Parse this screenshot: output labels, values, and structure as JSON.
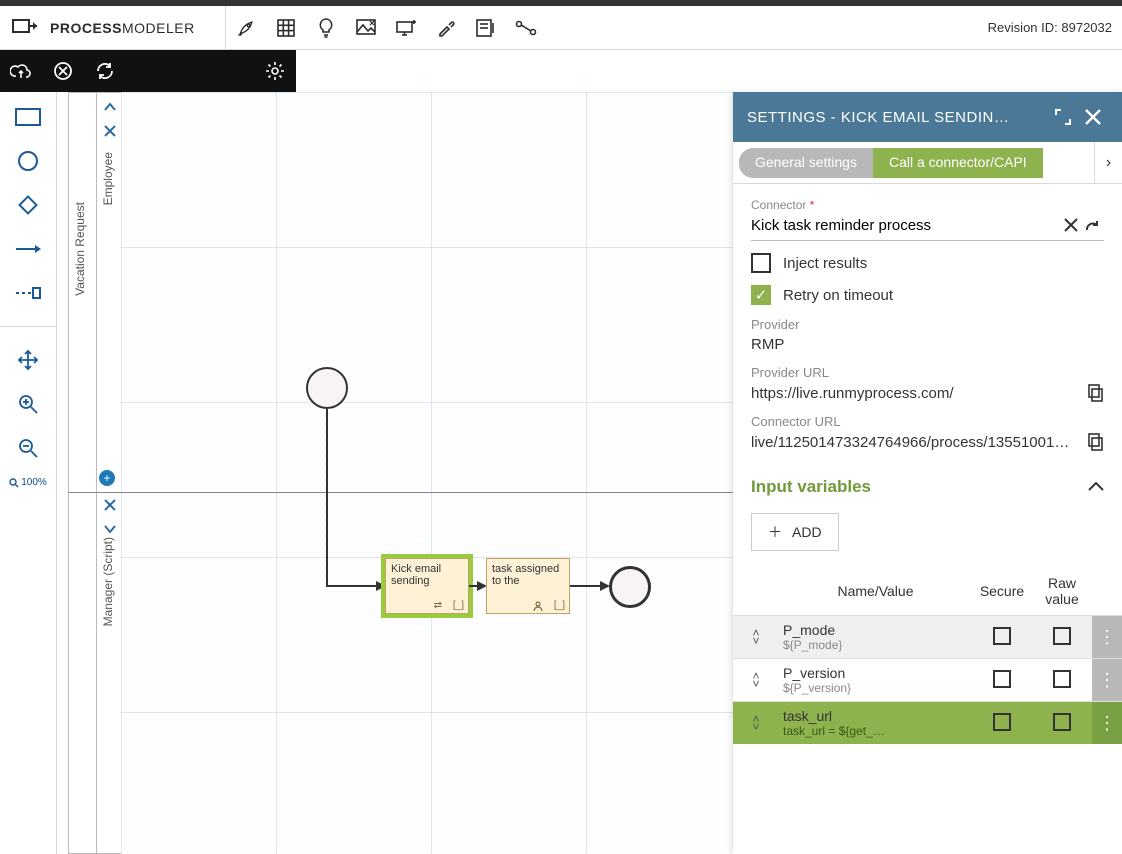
{
  "brand": {
    "strong": "PROCESS",
    "light": "MODELER"
  },
  "revision": {
    "label": "Revision ID: ",
    "value": "8972032"
  },
  "palette_zoom": "100%",
  "lanes": {
    "pool": "Vacation Request",
    "lane1": "Employee",
    "lane2": "Manager (Script)"
  },
  "nodes": {
    "task1": "Kick email sending",
    "task2": "task assigned to the"
  },
  "panel": {
    "title": "SETTINGS  -  KICK EMAIL SENDIN…",
    "tabs": {
      "general": "General settings",
      "call": "Call a connector/CAPI"
    },
    "connector_label": "Connector",
    "connector_value": "Kick task reminder process",
    "inject_label": "Inject results",
    "retry_label": "Retry on timeout",
    "provider_label": "Provider",
    "provider_value": "RMP",
    "provider_url_label": "Provider URL",
    "provider_url_value": "https://live.runmyprocess.com/",
    "connector_url_label": "Connector URL",
    "connector_url_value": "live/112501473324764966/process/13551001…",
    "inputvars_title": "Input variables",
    "add_label": "ADD",
    "cols": {
      "nv": "Name/Value",
      "secure": "Secure",
      "raw": "Raw value"
    },
    "rows": [
      {
        "name": "P_mode",
        "value": "${P_mode}",
        "sel": false
      },
      {
        "name": "P_version",
        "value": "${P_version}",
        "sel": false
      },
      {
        "name": "task_url",
        "value": "task_url = ${get_…",
        "sel": true
      }
    ]
  }
}
